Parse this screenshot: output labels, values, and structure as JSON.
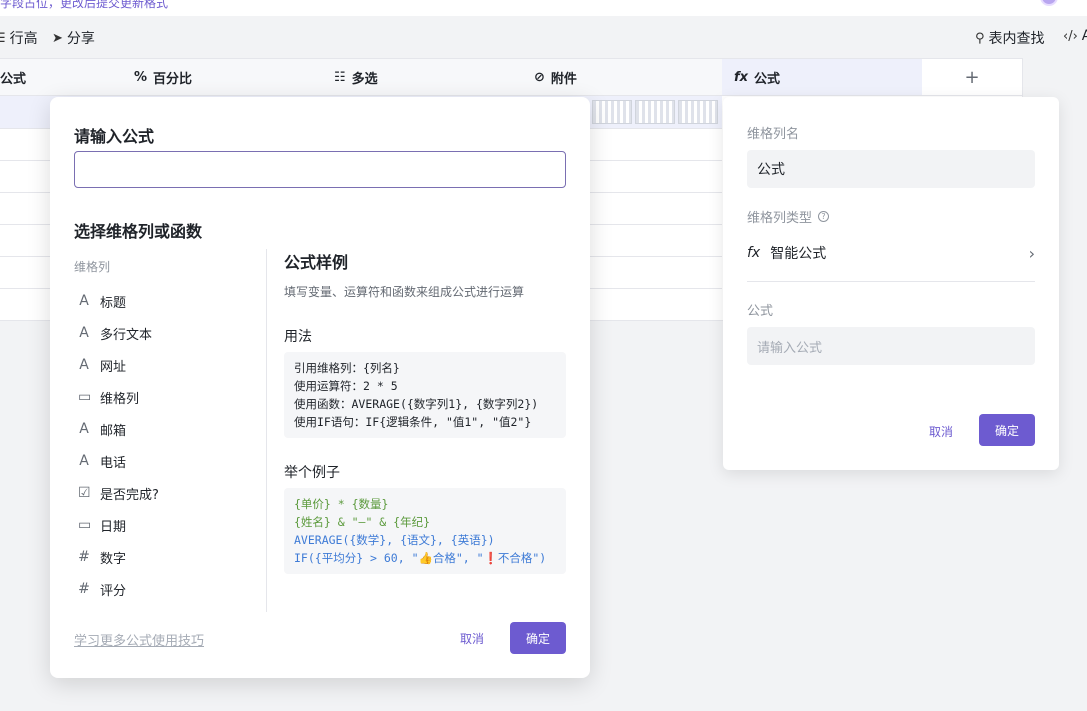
{
  "topbar": {
    "hint": "字段占位，更改后提交更新格式"
  },
  "toolbar": {
    "row_height": "行高",
    "share": "分享",
    "find": "表内查找",
    "api": "A"
  },
  "grid": {
    "columns": [
      {
        "label": "公式",
        "icon": "formula-icon"
      },
      {
        "label": "百分比",
        "icon": "percent-icon"
      },
      {
        "label": "多选",
        "icon": "multiselect-icon"
      },
      {
        "label": "附件",
        "icon": "paperclip-icon"
      },
      {
        "label": "公式",
        "icon": "fx-icon"
      }
    ],
    "add_column": "+"
  },
  "formula_dialog": {
    "title": "请输入公式",
    "input_value": "",
    "subtitle": "选择维格列或函数",
    "group_label": "维格列",
    "fields": [
      {
        "icon": "text-icon",
        "glyph": "A",
        "label": "标题"
      },
      {
        "icon": "text-icon",
        "glyph": "A",
        "label": "多行文本"
      },
      {
        "icon": "text-icon",
        "glyph": "A",
        "label": "网址"
      },
      {
        "icon": "calendar-icon",
        "glyph": "▭",
        "label": "维格列"
      },
      {
        "icon": "text-icon",
        "glyph": "A",
        "label": "邮箱"
      },
      {
        "icon": "text-icon",
        "glyph": "A",
        "label": "电话"
      },
      {
        "icon": "checkbox-icon",
        "glyph": "☑",
        "label": "是否完成?"
      },
      {
        "icon": "calendar-icon",
        "glyph": "▭",
        "label": "日期"
      },
      {
        "icon": "hash-icon",
        "glyph": "#",
        "label": "数字"
      },
      {
        "icon": "hash-icon",
        "glyph": "#",
        "label": "评分"
      }
    ],
    "example": {
      "title": "公式样例",
      "desc": "填写变量、运算符和函数来组成公式进行运算",
      "usage_heading": "用法",
      "usage_lines": [
        "引用维格列：{列名}",
        "使用运算符：2 * 5",
        "使用函数：AVERAGE({数字列1}, {数字列2})",
        "使用IF语句：IF{逻辑条件, \"值1\", \"值2\"}"
      ],
      "sample_heading": "举个例子",
      "sample_lines": [
        "{单价} * {数量}",
        "{姓名} & \"—\" & {年纪}",
        "AVERAGE({数学}, {语文}, {英语})",
        "IF({平均分} > 60, \"👍合格\", \"❗不合格\")"
      ]
    },
    "learn_link": "学习更多公式使用技巧",
    "cancel": "取消",
    "confirm": "确定"
  },
  "config_panel": {
    "name_label": "维格列名",
    "name_value": "公式",
    "type_label": "维格列类型",
    "type_value": "智能公式",
    "formula_label": "公式",
    "formula_placeholder": "请输入公式",
    "cancel": "取消",
    "confirm": "确定"
  },
  "colors": {
    "accent": "#6d5bd0",
    "active_column_bg": "#eef0fb"
  }
}
